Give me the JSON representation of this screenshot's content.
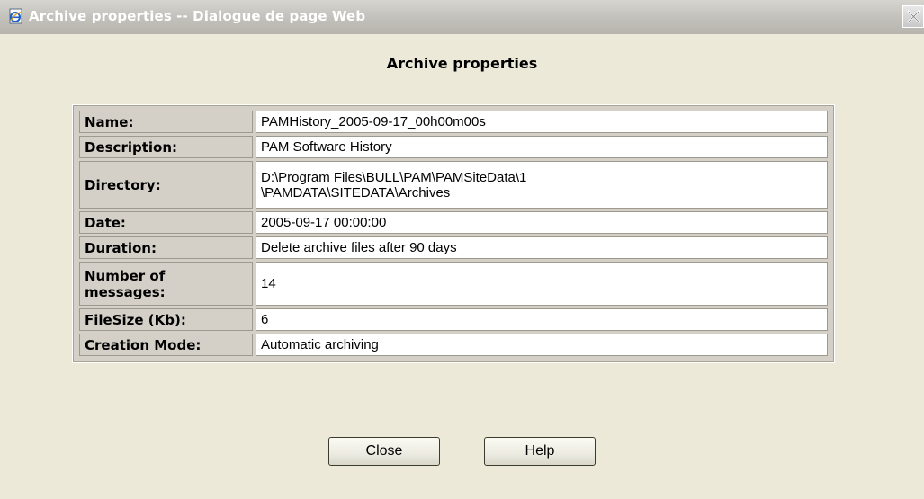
{
  "window": {
    "title": "Archive properties -- Dialogue de page Web",
    "icon": "ie-page-icon",
    "close_icon": "close-x-icon"
  },
  "dialog": {
    "heading": "Archive properties"
  },
  "properties": [
    {
      "label": "Name:",
      "value": "PAMHistory_2005-09-17_00h00m00s"
    },
    {
      "label": "Description:",
      "value": "PAM Software History"
    },
    {
      "label": "Directory:",
      "value_line1": "D:\\Program Files\\BULL\\PAM\\PAMSiteData\\1",
      "value_line2": "\\PAMDATA\\SITEDATA\\Archives"
    },
    {
      "label": "Date:",
      "value": "2005-09-17 00:00:00"
    },
    {
      "label": "Duration:",
      "value": "Delete archive files after 90 days"
    },
    {
      "label_line1": "Number of",
      "label_line2": "messages:",
      "value": "14"
    },
    {
      "label": "FileSize (Kb):",
      "value": "6"
    },
    {
      "label": "Creation Mode:",
      "value": "Automatic archiving"
    }
  ],
  "buttons": {
    "close_label": "Close",
    "help_label": "Help"
  },
  "colors": {
    "dialog_background": "#ece9d8",
    "title_bar": "#c4c3bd",
    "cell_value_background": "#ffffff"
  }
}
